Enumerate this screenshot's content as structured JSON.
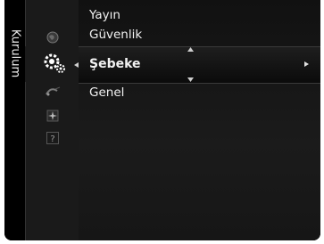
{
  "menu": {
    "category_label": "Kurulum",
    "items": [
      {
        "label": "Yayın"
      },
      {
        "label": "Güvenlik"
      },
      {
        "label": "Şebeke",
        "selected": true
      },
      {
        "label": "Genel"
      }
    ]
  },
  "icons": [
    "globe-icon",
    "gear-icon",
    "satellite-icon",
    "sparkle-icon",
    "help-icon"
  ]
}
